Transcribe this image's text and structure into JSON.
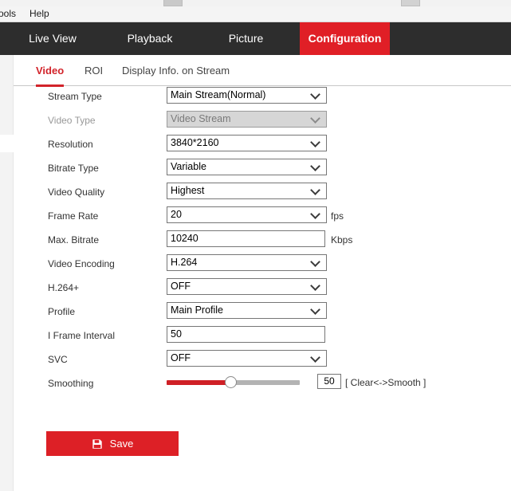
{
  "window": {
    "menu_items": [
      "ools",
      "Help"
    ]
  },
  "topnav": {
    "tabs": [
      {
        "label": "Live View",
        "active": false
      },
      {
        "label": "Playback",
        "active": false
      },
      {
        "label": "Picture",
        "active": false
      },
      {
        "label": "Configuration",
        "active": true
      }
    ],
    "active_color": "#e01f26",
    "bar_color": "#2d2d2d"
  },
  "subtabs": {
    "items": [
      {
        "label": "Video",
        "active": true
      },
      {
        "label": "ROI",
        "active": false
      },
      {
        "label": "Display Info. on Stream",
        "active": false
      }
    ],
    "active_color": "#d2232a"
  },
  "form": {
    "rows": [
      {
        "label": "Stream Type",
        "type": "select",
        "value": "Main Stream(Normal)",
        "unit": "",
        "disabled": false
      },
      {
        "label": "Video Type",
        "type": "select",
        "value": "Video Stream",
        "unit": "",
        "disabled": true
      },
      {
        "label": "Resolution",
        "type": "select",
        "value": "3840*2160",
        "unit": "",
        "disabled": false
      },
      {
        "label": "Bitrate Type",
        "type": "select",
        "value": "Variable",
        "unit": "",
        "disabled": false
      },
      {
        "label": "Video Quality",
        "type": "select",
        "value": "Highest",
        "unit": "",
        "disabled": false
      },
      {
        "label": "Frame Rate",
        "type": "select",
        "value": "20",
        "unit": "fps",
        "disabled": false
      },
      {
        "label": "Max. Bitrate",
        "type": "text",
        "value": "10240",
        "unit": "Kbps",
        "disabled": false
      },
      {
        "label": "Video Encoding",
        "type": "select",
        "value": "H.264",
        "unit": "",
        "disabled": false
      },
      {
        "label": "H.264+",
        "type": "select",
        "value": "OFF",
        "unit": "",
        "disabled": false
      },
      {
        "label": "Profile",
        "type": "select",
        "value": "Main Profile",
        "unit": "",
        "disabled": false
      },
      {
        "label": "I Frame Interval",
        "type": "text",
        "value": "50",
        "unit": "",
        "disabled": false
      },
      {
        "label": "SVC",
        "type": "select",
        "value": "OFF",
        "unit": "",
        "disabled": false
      }
    ],
    "smoothing": {
      "label": "Smoothing",
      "value": "50",
      "percent": 48,
      "hint": "[ Clear<->Smooth ]",
      "fill_color": "#cf2026"
    },
    "save": {
      "label": "Save",
      "icon": "floppy-disk-icon",
      "color": "#dd2026"
    }
  }
}
